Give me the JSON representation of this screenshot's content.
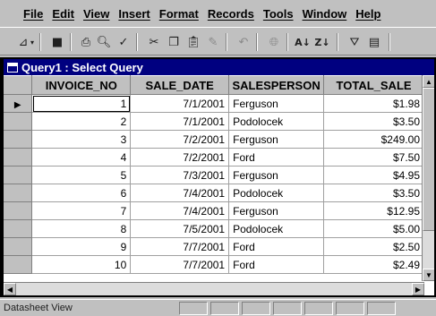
{
  "menu": [
    "File",
    "Edit",
    "View",
    "Insert",
    "Format",
    "Records",
    "Tools",
    "Window",
    "Help"
  ],
  "toolbar_icons": [
    "design-view-icon",
    "save-icon",
    "print-icon",
    "print-preview-icon",
    "spelling-icon",
    "cut-icon",
    "copy-icon",
    "paste-icon",
    "format-painter-icon",
    "undo-icon",
    "hyperlink-icon",
    "sort-ascending-icon",
    "sort-descending-icon",
    "filter-by-selection-icon",
    "filter-by-form-icon"
  ],
  "window": {
    "title": "Query1 : Select Query"
  },
  "columns": [
    "INVOICE_NO",
    "SALE_DATE",
    "SALESPERSON",
    "TOTAL_SALE"
  ],
  "rows": [
    {
      "invoice": "1",
      "date": "7/1/2001",
      "person": "Ferguson",
      "total": "$1.98"
    },
    {
      "invoice": "2",
      "date": "7/1/2001",
      "person": "Podolocek",
      "total": "$3.50"
    },
    {
      "invoice": "3",
      "date": "7/2/2001",
      "person": "Ferguson",
      "total": "$249.00"
    },
    {
      "invoice": "4",
      "date": "7/2/2001",
      "person": "Ford",
      "total": "$7.50"
    },
    {
      "invoice": "5",
      "date": "7/3/2001",
      "person": "Ferguson",
      "total": "$4.95"
    },
    {
      "invoice": "6",
      "date": "7/4/2001",
      "person": "Podolocek",
      "total": "$3.50"
    },
    {
      "invoice": "7",
      "date": "7/4/2001",
      "person": "Ferguson",
      "total": "$12.95"
    },
    {
      "invoice": "8",
      "date": "7/5/2001",
      "person": "Podolocek",
      "total": "$5.00"
    },
    {
      "invoice": "9",
      "date": "7/7/2001",
      "person": "Ford",
      "total": "$2.50"
    },
    {
      "invoice": "10",
      "date": "7/7/2001",
      "person": "Ford",
      "total": "$2.49"
    }
  ],
  "current_row_marker": "▶",
  "status": {
    "text": "Datasheet View"
  },
  "colors": {
    "title_bar": "#000080",
    "chrome": "#c0c0c0"
  }
}
